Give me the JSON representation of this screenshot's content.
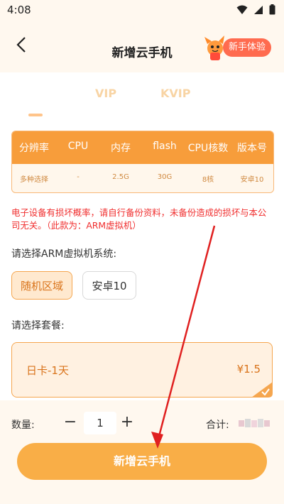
{
  "status_bar": {
    "time": "4:08"
  },
  "header": {
    "title": "新增云手机",
    "trial_badge": "新手体验"
  },
  "tabs": [
    {
      "label": "VIP"
    },
    {
      "label": "KVIP"
    }
  ],
  "spec_table": {
    "headers": [
      "分辨率",
      "CPU",
      "内存",
      "flash",
      "CPU核数",
      "版本号"
    ],
    "values": [
      "多种选择",
      "-",
      "2.5G",
      "30G",
      "8核",
      "安卓10"
    ]
  },
  "warning": "电子设备有损坏概率，请自行备份资料，未备份造成的损坏与本公司无关。（此款为：ARM虚拟机）",
  "system_section": {
    "label": "请选择ARM虚拟机系统:",
    "options": [
      "随机区域",
      "安卓10"
    ],
    "selected": "随机区域"
  },
  "package_section": {
    "label": "请选择套餐:",
    "package_name": "日卡-1天",
    "package_price": "¥1.5"
  },
  "quantity": {
    "label": "数量:",
    "minus": "−",
    "value": "1",
    "plus": "+"
  },
  "total": {
    "label": "合计:"
  },
  "submit_label": "新增云手机",
  "colors": {
    "accent": "#f79d3b",
    "button": "#f9ae47",
    "warning": "#f02e2e",
    "badge": "#ff6b4f",
    "arrow": "#e02020"
  }
}
